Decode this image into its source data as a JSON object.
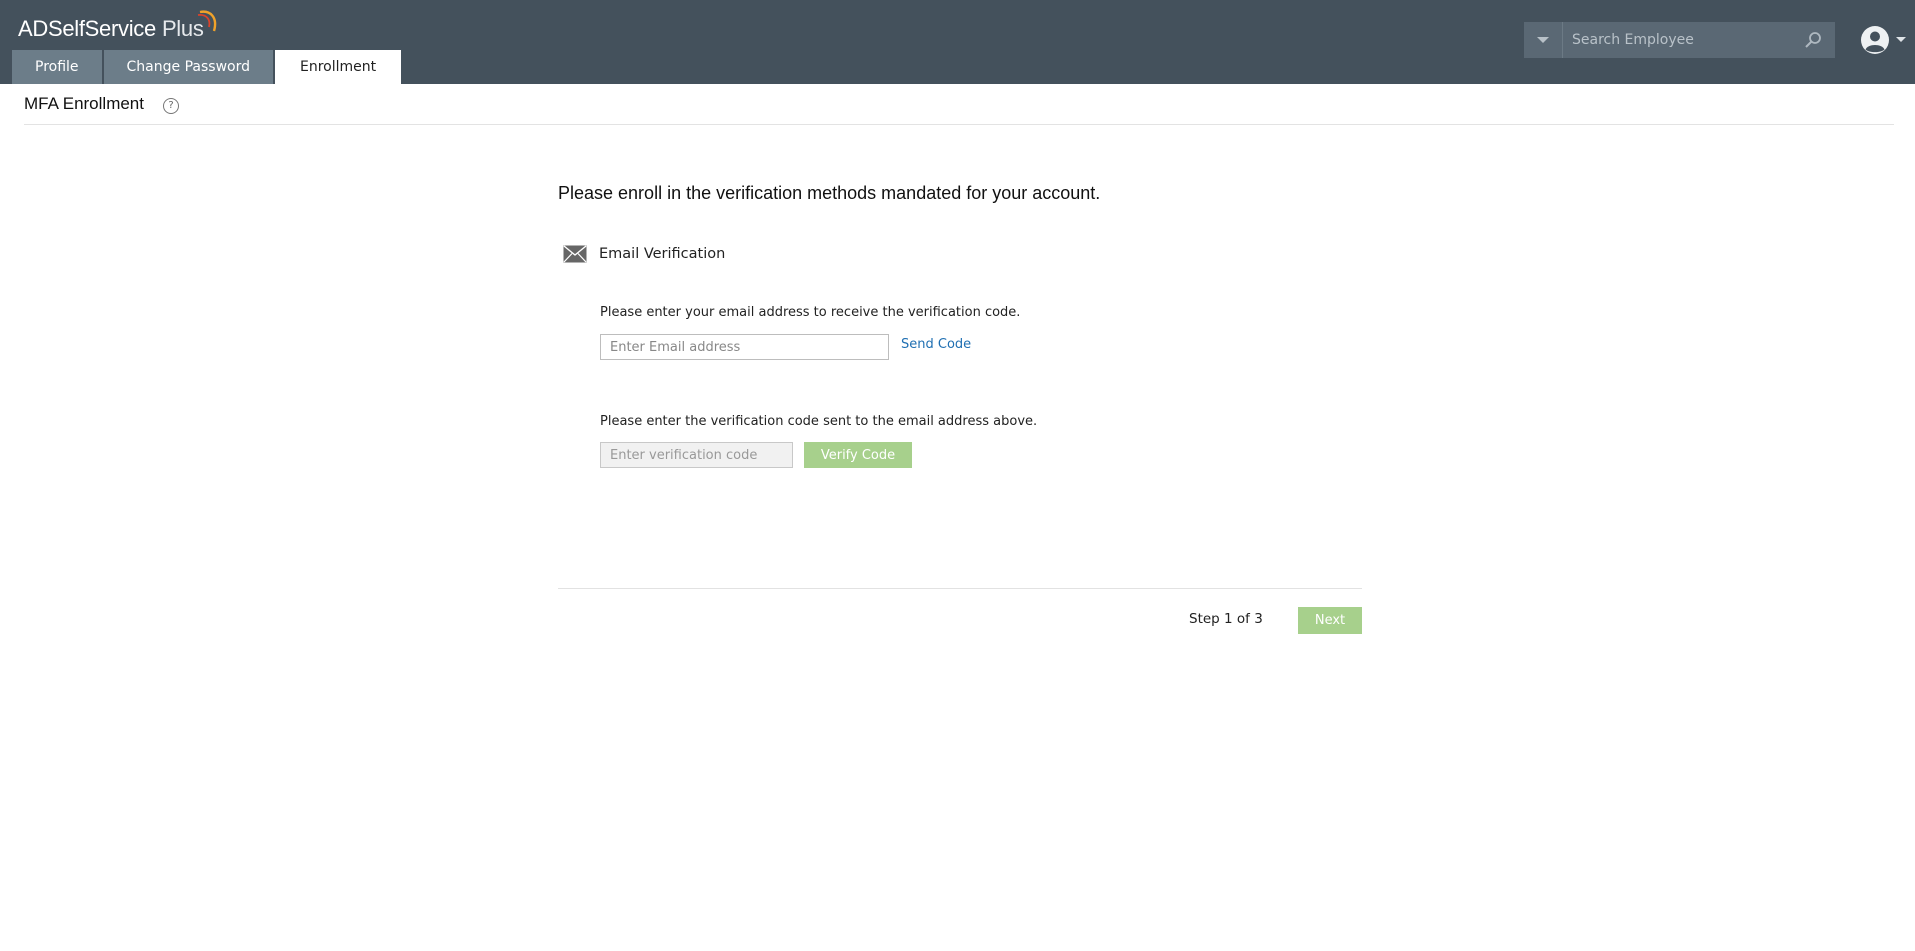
{
  "app": {
    "title_main": "ADSelfService",
    "title_plus": "Plus",
    "icons": {
      "logo_arc": "orange-red-arc-logo",
      "account": "user-circle-icon"
    }
  },
  "tabs": [
    {
      "label": "Profile",
      "active": false
    },
    {
      "label": "Change Password",
      "active": false
    },
    {
      "label": "Enrollment",
      "active": true
    }
  ],
  "search": {
    "placeholder": "Search Employee",
    "value": ""
  },
  "page": {
    "title": "MFA Enrollment",
    "help_icon": "?"
  },
  "enrollment": {
    "intro": "Please enroll in the verification methods mandated for your account.",
    "method": {
      "label": "Email Verification",
      "icon": "envelope-icon"
    },
    "email_prompt": "Please enter your email address to receive the verification code.",
    "email_placeholder": "Enter Email address",
    "email_value": "",
    "send_code": "Send Code",
    "code_prompt": "Please enter the verification code sent to the email address above.",
    "code_placeholder": "Enter verification code",
    "code_value": "",
    "verify_button": "Verify Code"
  },
  "footer": {
    "step": "Step 1 of 3",
    "next_button": "Next"
  },
  "colors": {
    "header_bg": "#44515c",
    "tab_bg": "#6c7d89",
    "link": "#1f6fb2",
    "button_disabled": "#a7d08c"
  }
}
